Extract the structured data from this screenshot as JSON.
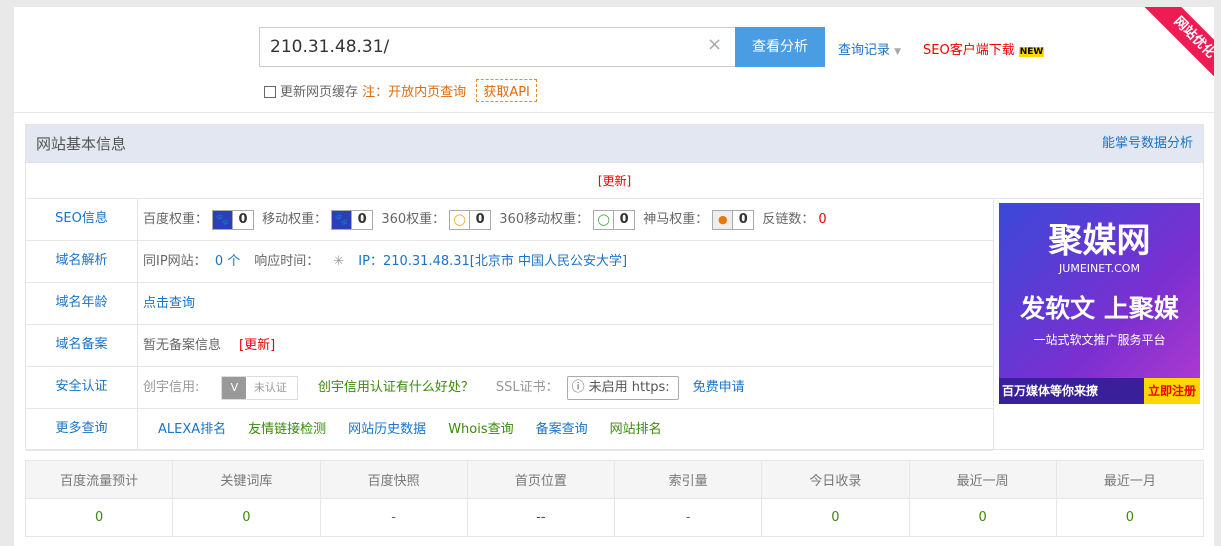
{
  "search": {
    "value": "210.31.48.31/",
    "button": "查看分析",
    "history": "查询记录",
    "seo_client": "SEO客户端下载",
    "new_badge": "NEW",
    "clear": "×"
  },
  "options": {
    "refresh_cache": "更新网页缓存",
    "note": "注：开放内页查询",
    "api": "获取API"
  },
  "corner_ribbon": "网站优化",
  "basic": {
    "title": "网站基本信息",
    "analysis_link": "能掌号数据分析",
    "update": "[更新]"
  },
  "rows": {
    "seo": {
      "label": "SEO信息",
      "items": [
        {
          "name": "百度权重：",
          "value": "0"
        },
        {
          "name": "移动权重：",
          "value": "0"
        },
        {
          "name": "360权重：",
          "value": "0"
        },
        {
          "name": "360移动权重：",
          "value": "0"
        },
        {
          "name": "神马权重：",
          "value": "0"
        }
      ],
      "backlinks_label": "反链数：",
      "backlinks": "0"
    },
    "dns": {
      "label": "域名解析",
      "same_ip_label": "同IP网站：",
      "same_ip": "0 个",
      "response_label": "响应时间：",
      "ip": "IP：210.31.48.31[北京市 中国人民公安大学]"
    },
    "age": {
      "label": "域名年龄",
      "link": "点击查询"
    },
    "icp": {
      "label": "域名备案",
      "text": "暂无备案信息",
      "update": "[更新]"
    },
    "security": {
      "label": "安全认证",
      "credit_label": "创宇信用:",
      "credit_badge": "未认证",
      "credit_link": "创宇信用认证有什么好处？",
      "ssl_label": "SSL证书：",
      "ssl_value": "未启用 https:",
      "ssl_apply": "免费申请"
    },
    "more": {
      "label": "更多查询",
      "links": [
        "ALEXA排名",
        "友情链接检测",
        "网站历史数据",
        "Whois查询",
        "备案查询",
        "网站排名"
      ]
    }
  },
  "ad": {
    "brand": "聚媒网",
    "domain": "JUMEINET.COM",
    "slogan": "发软文 上聚媒",
    "sub": "一站式软文推广服务平台",
    "bottom": "百万媒体等你来撩",
    "cta": "立即注册"
  },
  "stats": {
    "headers": [
      "百度流量预计",
      "关键词库",
      "百度快照",
      "首页位置",
      "索引量",
      "今日收录",
      "最近一周",
      "最近一月"
    ],
    "values": [
      "0",
      "0",
      "-",
      "--",
      "-",
      "0",
      "0",
      "0"
    ]
  }
}
